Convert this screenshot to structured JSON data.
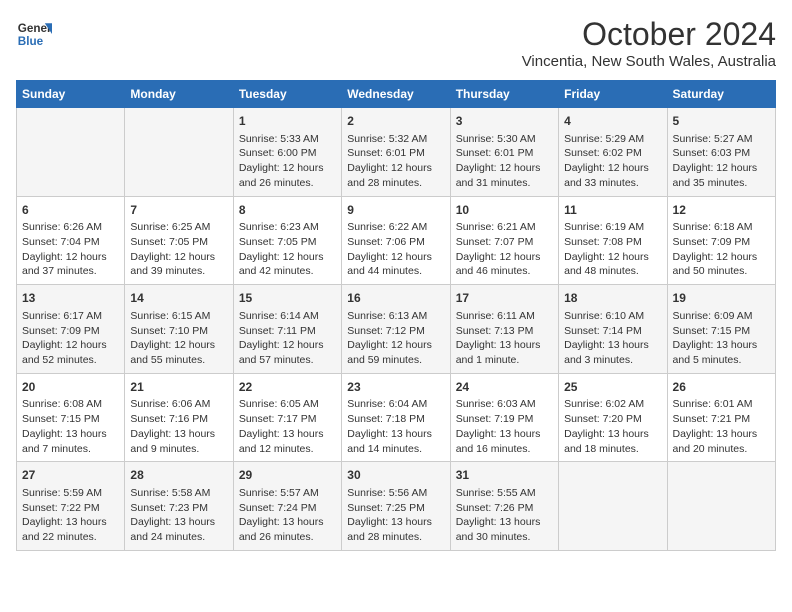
{
  "logo": {
    "line1": "General",
    "line2": "Blue"
  },
  "title": "October 2024",
  "location": "Vincentia, New South Wales, Australia",
  "days_header": [
    "Sunday",
    "Monday",
    "Tuesday",
    "Wednesday",
    "Thursday",
    "Friday",
    "Saturday"
  ],
  "weeks": [
    [
      {
        "day": "",
        "content": ""
      },
      {
        "day": "",
        "content": ""
      },
      {
        "day": "1",
        "content": "Sunrise: 5:33 AM\nSunset: 6:00 PM\nDaylight: 12 hours\nand 26 minutes."
      },
      {
        "day": "2",
        "content": "Sunrise: 5:32 AM\nSunset: 6:01 PM\nDaylight: 12 hours\nand 28 minutes."
      },
      {
        "day": "3",
        "content": "Sunrise: 5:30 AM\nSunset: 6:01 PM\nDaylight: 12 hours\nand 31 minutes."
      },
      {
        "day": "4",
        "content": "Sunrise: 5:29 AM\nSunset: 6:02 PM\nDaylight: 12 hours\nand 33 minutes."
      },
      {
        "day": "5",
        "content": "Sunrise: 5:27 AM\nSunset: 6:03 PM\nDaylight: 12 hours\nand 35 minutes."
      }
    ],
    [
      {
        "day": "6",
        "content": "Sunrise: 6:26 AM\nSunset: 7:04 PM\nDaylight: 12 hours\nand 37 minutes."
      },
      {
        "day": "7",
        "content": "Sunrise: 6:25 AM\nSunset: 7:05 PM\nDaylight: 12 hours\nand 39 minutes."
      },
      {
        "day": "8",
        "content": "Sunrise: 6:23 AM\nSunset: 7:05 PM\nDaylight: 12 hours\nand 42 minutes."
      },
      {
        "day": "9",
        "content": "Sunrise: 6:22 AM\nSunset: 7:06 PM\nDaylight: 12 hours\nand 44 minutes."
      },
      {
        "day": "10",
        "content": "Sunrise: 6:21 AM\nSunset: 7:07 PM\nDaylight: 12 hours\nand 46 minutes."
      },
      {
        "day": "11",
        "content": "Sunrise: 6:19 AM\nSunset: 7:08 PM\nDaylight: 12 hours\nand 48 minutes."
      },
      {
        "day": "12",
        "content": "Sunrise: 6:18 AM\nSunset: 7:09 PM\nDaylight: 12 hours\nand 50 minutes."
      }
    ],
    [
      {
        "day": "13",
        "content": "Sunrise: 6:17 AM\nSunset: 7:09 PM\nDaylight: 12 hours\nand 52 minutes."
      },
      {
        "day": "14",
        "content": "Sunrise: 6:15 AM\nSunset: 7:10 PM\nDaylight: 12 hours\nand 55 minutes."
      },
      {
        "day": "15",
        "content": "Sunrise: 6:14 AM\nSunset: 7:11 PM\nDaylight: 12 hours\nand 57 minutes."
      },
      {
        "day": "16",
        "content": "Sunrise: 6:13 AM\nSunset: 7:12 PM\nDaylight: 12 hours\nand 59 minutes."
      },
      {
        "day": "17",
        "content": "Sunrise: 6:11 AM\nSunset: 7:13 PM\nDaylight: 13 hours\nand 1 minute."
      },
      {
        "day": "18",
        "content": "Sunrise: 6:10 AM\nSunset: 7:14 PM\nDaylight: 13 hours\nand 3 minutes."
      },
      {
        "day": "19",
        "content": "Sunrise: 6:09 AM\nSunset: 7:15 PM\nDaylight: 13 hours\nand 5 minutes."
      }
    ],
    [
      {
        "day": "20",
        "content": "Sunrise: 6:08 AM\nSunset: 7:15 PM\nDaylight: 13 hours\nand 7 minutes."
      },
      {
        "day": "21",
        "content": "Sunrise: 6:06 AM\nSunset: 7:16 PM\nDaylight: 13 hours\nand 9 minutes."
      },
      {
        "day": "22",
        "content": "Sunrise: 6:05 AM\nSunset: 7:17 PM\nDaylight: 13 hours\nand 12 minutes."
      },
      {
        "day": "23",
        "content": "Sunrise: 6:04 AM\nSunset: 7:18 PM\nDaylight: 13 hours\nand 14 minutes."
      },
      {
        "day": "24",
        "content": "Sunrise: 6:03 AM\nSunset: 7:19 PM\nDaylight: 13 hours\nand 16 minutes."
      },
      {
        "day": "25",
        "content": "Sunrise: 6:02 AM\nSunset: 7:20 PM\nDaylight: 13 hours\nand 18 minutes."
      },
      {
        "day": "26",
        "content": "Sunrise: 6:01 AM\nSunset: 7:21 PM\nDaylight: 13 hours\nand 20 minutes."
      }
    ],
    [
      {
        "day": "27",
        "content": "Sunrise: 5:59 AM\nSunset: 7:22 PM\nDaylight: 13 hours\nand 22 minutes."
      },
      {
        "day": "28",
        "content": "Sunrise: 5:58 AM\nSunset: 7:23 PM\nDaylight: 13 hours\nand 24 minutes."
      },
      {
        "day": "29",
        "content": "Sunrise: 5:57 AM\nSunset: 7:24 PM\nDaylight: 13 hours\nand 26 minutes."
      },
      {
        "day": "30",
        "content": "Sunrise: 5:56 AM\nSunset: 7:25 PM\nDaylight: 13 hours\nand 28 minutes."
      },
      {
        "day": "31",
        "content": "Sunrise: 5:55 AM\nSunset: 7:26 PM\nDaylight: 13 hours\nand 30 minutes."
      },
      {
        "day": "",
        "content": ""
      },
      {
        "day": "",
        "content": ""
      }
    ]
  ]
}
